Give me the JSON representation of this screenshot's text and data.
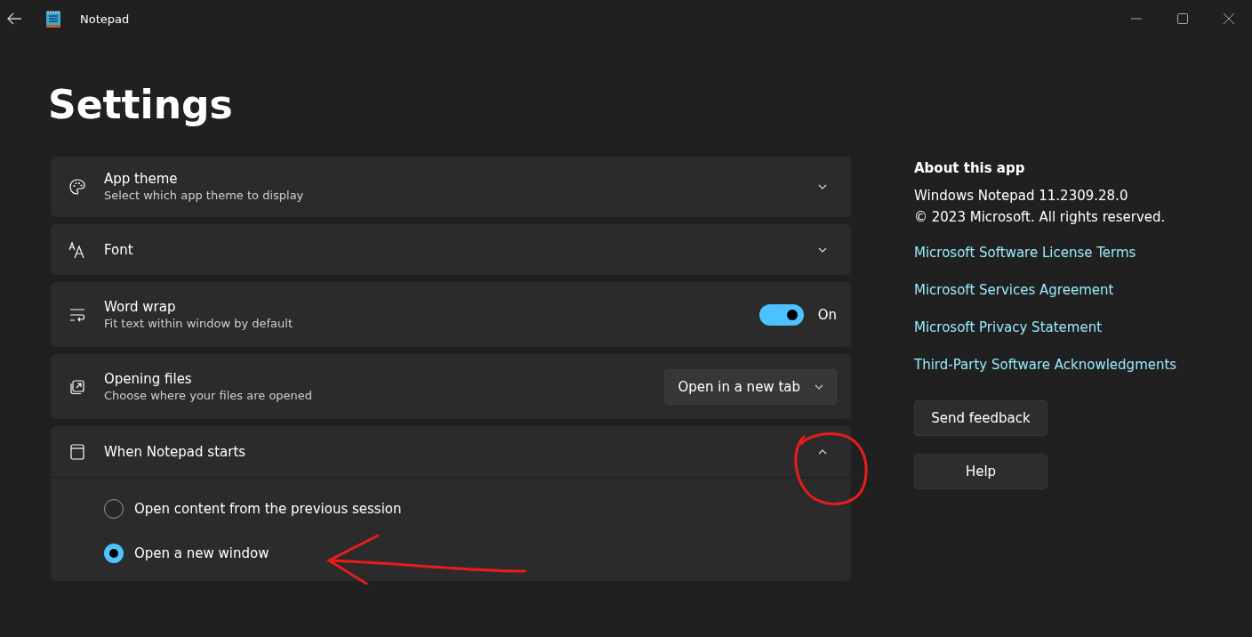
{
  "window": {
    "title": "Notepad"
  },
  "page": {
    "title": "Settings"
  },
  "settings": [
    {
      "kind": "expander",
      "title": "App theme",
      "subtitle": "Select which app theme to display",
      "expanded": false
    },
    {
      "kind": "expander",
      "title": "Font",
      "expanded": false
    },
    {
      "kind": "toggle",
      "title": "Word wrap",
      "subtitle": "Fit text within window by default",
      "on": true,
      "state_label": "On"
    },
    {
      "kind": "dropdown",
      "title": "Opening files",
      "subtitle": "Choose where your files are opened",
      "value": "Open in a new tab"
    },
    {
      "kind": "expander",
      "title": "When Notepad starts",
      "expanded": true,
      "options": [
        {
          "label": "Open content from the previous session",
          "selected": false
        },
        {
          "label": "Open a new window",
          "selected": true
        }
      ]
    }
  ],
  "about": {
    "heading": "About this app",
    "version": "Windows Notepad 11.2309.28.0",
    "copyright": "© 2023 Microsoft. All rights reserved.",
    "links": [
      "Microsoft Software License Terms",
      "Microsoft Services Agreement",
      "Microsoft Privacy Statement",
      "Third-Party Software Acknowledgments"
    ],
    "buttons": [
      "Send feedback",
      "Help"
    ]
  }
}
